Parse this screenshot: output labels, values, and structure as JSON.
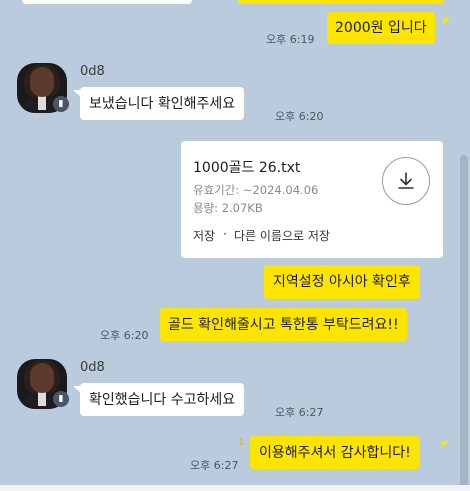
{
  "messages": [
    {
      "side": "right",
      "text": "2000원 입니다",
      "time": "오후 6:19"
    },
    {
      "side": "left",
      "sender": "0d8",
      "text": "보냈습니다 확인해주세요",
      "time": "오후 6:20"
    },
    {
      "side": "right",
      "type": "file",
      "file": {
        "name": "1000골드 26.txt",
        "expiry": "유효기간: ~2024.04.06",
        "size": "용량: 2.07KB",
        "save": "저장",
        "sep": "·",
        "save_as": "다른 이름으로 저장"
      }
    },
    {
      "side": "right",
      "text": "지역설정 아시아 확인후"
    },
    {
      "side": "right",
      "text": "골드 확인해줄시고 톡한통 부탁드려요!!",
      "time": "오후 6:20"
    },
    {
      "side": "left",
      "sender": "0d8",
      "text": "확인했습니다 수고하세요",
      "time": "오후 6:27"
    },
    {
      "side": "right",
      "text": "이용해주셔서 감사합니다!",
      "time": "오후 6:27",
      "unread": "1"
    }
  ],
  "icons": {
    "download": "download-icon",
    "avatar_badge": "profile-badge-icon"
  },
  "colors": {
    "background": "#b9cbdd",
    "my_bubble": "#fee500",
    "their_bubble": "#ffffff",
    "unread": "#f5c518"
  }
}
